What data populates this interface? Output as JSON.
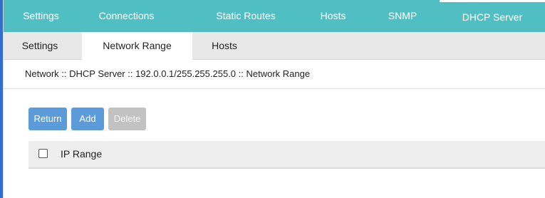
{
  "main_tabs": [
    {
      "label": "Settings"
    },
    {
      "label": "Connections"
    },
    {
      "label": "Static Routes"
    },
    {
      "label": "Hosts"
    },
    {
      "label": "SNMP"
    },
    {
      "label": "DHCP Server",
      "active": true
    }
  ],
  "sub_tabs": [
    {
      "label": "Settings"
    },
    {
      "label": "Network Range",
      "active": true
    },
    {
      "label": "Hosts"
    }
  ],
  "breadcrumb": "Network :: DHCP Server :: 192.0.0.1/255.255.255.0 :: Network Range",
  "buttons": {
    "return_label": "Return",
    "add_label": "Add",
    "delete_label": "Delete"
  },
  "table": {
    "columns": [
      "IP Range"
    ],
    "rows": []
  },
  "colors": {
    "main_tab_bg": "#4fbfc3",
    "button_primary": "#5b9bd9",
    "button_disabled": "#c2c2c2"
  }
}
